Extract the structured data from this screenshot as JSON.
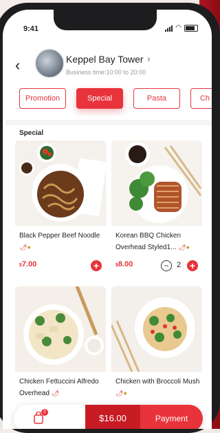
{
  "status": {
    "time": "9:41"
  },
  "store": {
    "name": "Keppel Bay Tower",
    "business_time": "Business time:10:00 to 20:00"
  },
  "tabs": [
    {
      "label": "Promotion",
      "active": false
    },
    {
      "label": "Special",
      "active": true
    },
    {
      "label": "Pasta",
      "active": false
    },
    {
      "label": "Ch",
      "active": false
    }
  ],
  "section_title": "Special",
  "products": [
    {
      "name": "Black Pepper Beef Noodle",
      "currency": "$",
      "price": "7.00"
    },
    {
      "name": "Korean BBQ Chicken Overhead Styled1...",
      "currency": "$",
      "price": "8.00",
      "quantity": "2"
    },
    {
      "name": "Chicken Fettuccini Alfredo Overhead"
    },
    {
      "name": "Chicken with Broccoli Mush"
    }
  ],
  "cart": {
    "badge": "2",
    "total": "$16.00",
    "payment_label": "Payment"
  },
  "colors": {
    "accent": "#e8333b",
    "accent_dark": "#c81c25"
  },
  "icons": {
    "back": "chevron-left-icon",
    "store_chevron": "chevron-right-icon",
    "bag": "shopping-bag-icon",
    "add": "plus-icon",
    "minus": "minus-icon",
    "spicy": "chili-icon",
    "veg": "corn-icon"
  }
}
